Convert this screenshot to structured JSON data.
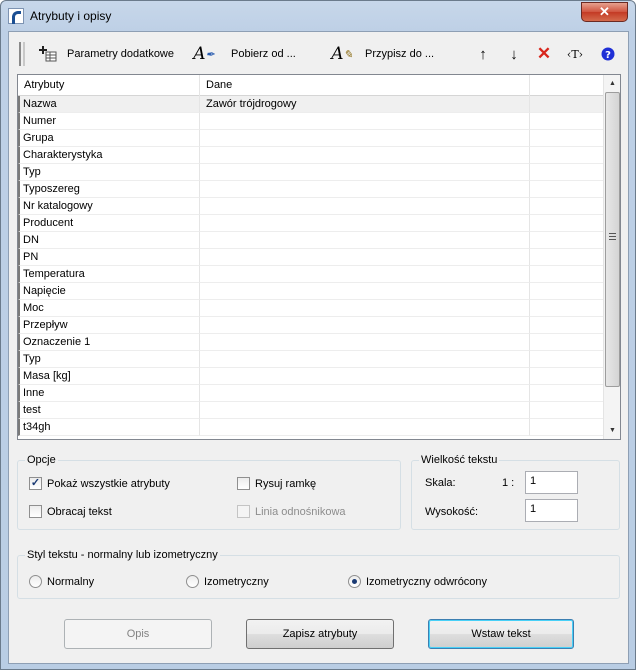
{
  "window": {
    "title": "Atrybuty i opisy"
  },
  "toolbar": {
    "params_label": "Parametry dodatkowe",
    "fetch_label": "Pobierz od ...",
    "assign_label": "Przypisz do ...",
    "insert_text_glyph": "‹T›"
  },
  "grid": {
    "columns": [
      "Atrybuty",
      "Dane"
    ],
    "rows": [
      [
        "Nazwa",
        "Zawór trójdrogowy"
      ],
      [
        "Numer",
        ""
      ],
      [
        "Grupa",
        ""
      ],
      [
        "Charakterystyka",
        ""
      ],
      [
        "Typ",
        ""
      ],
      [
        "Typoszereg",
        ""
      ],
      [
        "Nr katalogowy",
        ""
      ],
      [
        "Producent",
        ""
      ],
      [
        "DN",
        ""
      ],
      [
        "PN",
        ""
      ],
      [
        "Temperatura",
        ""
      ],
      [
        "Napięcie",
        ""
      ],
      [
        "Moc",
        ""
      ],
      [
        "Przepływ",
        ""
      ],
      [
        "Oznaczenie 1",
        ""
      ],
      [
        "Typ",
        ""
      ],
      [
        "Masa [kg]",
        ""
      ],
      [
        "Inne",
        ""
      ],
      [
        "test",
        ""
      ],
      [
        "t34gh",
        ""
      ]
    ]
  },
  "options": {
    "title": "Opcje",
    "show_all": {
      "label": "Pokaż wszystkie atrybuty",
      "checked": true
    },
    "draw_frame": {
      "label": "Rysuj ramkę",
      "checked": false
    },
    "rotate_text": {
      "label": "Obracaj tekst",
      "checked": false
    },
    "leader_line": {
      "label": "Linia odnośnikowa",
      "checked": false,
      "disabled": true
    }
  },
  "text_size": {
    "title": "Wielkość tekstu",
    "scale_label": "Skala:",
    "scale_prefix": "1 :",
    "scale_value": "1",
    "height_label": "Wysokość:",
    "height_value": "1"
  },
  "text_style": {
    "title": "Styl tekstu - normalny lub izometryczny",
    "normal": "Normalny",
    "iso": "Izometryczny",
    "iso_rev": "Izometryczny odwrócony",
    "selected": "iso_rev"
  },
  "buttons": {
    "opis": "Opis",
    "save_attrs": "Zapisz atrybuty",
    "insert_text": "Wstaw tekst"
  }
}
